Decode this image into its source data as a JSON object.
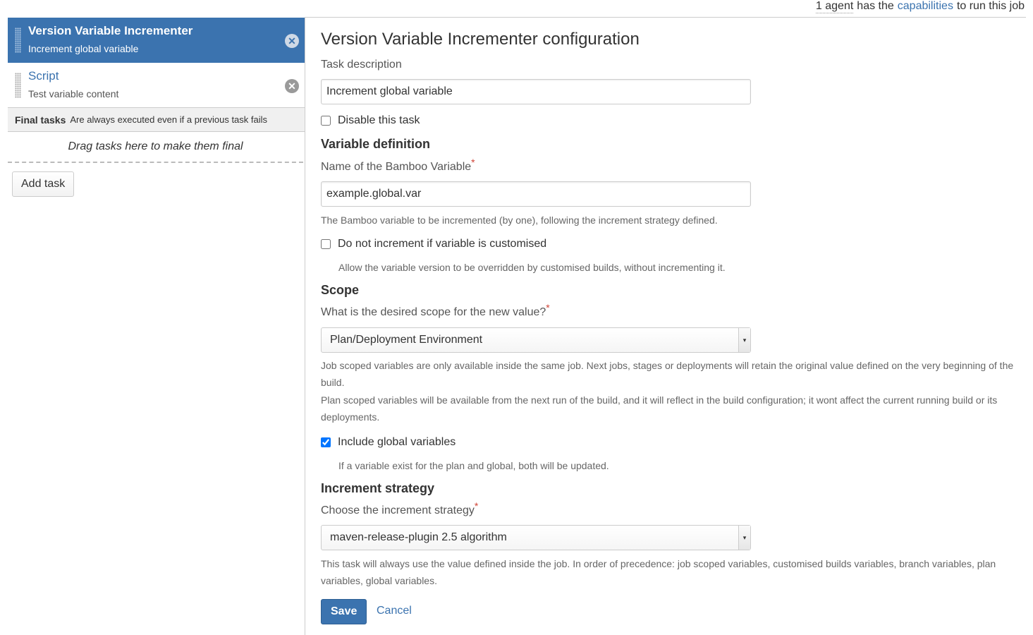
{
  "topbar": {
    "agents_text": "1 agent",
    "has_the": "has the",
    "capabilities_link": "capabilities",
    "tail": "to run this job"
  },
  "tasks": [
    {
      "title": "Version Variable Incrementer",
      "subtitle": "Increment global variable",
      "active": true
    },
    {
      "title": "Script",
      "subtitle": "Test variable content",
      "active": false
    }
  ],
  "final_tasks": {
    "label": "Final tasks",
    "note": "Are always executed even if a previous task fails",
    "dropzone": "Drag tasks here to make them final"
  },
  "add_task_label": "Add task",
  "config": {
    "title": "Version Variable Incrementer configuration",
    "task_description_label": "Task description",
    "task_description_value": "Increment global variable",
    "disable_task_label": "Disable this task",
    "variable_definition_heading": "Variable definition",
    "variable_name_label": "Name of the Bamboo Variable",
    "variable_name_value": "example.global.var",
    "variable_name_help": "The Bamboo variable to be incremented (by one), following the increment strategy defined.",
    "no_increment_label": "Do not increment if variable is customised",
    "no_increment_help": "Allow the variable version to be overridden by customised builds, without incrementing it.",
    "scope_heading": "Scope",
    "scope_label": "What is the desired scope for the new value?",
    "scope_value": "Plan/Deployment Environment",
    "scope_help_1": "Job scoped variables are only available inside the same job. Next jobs, stages or deployments will retain the original value defined on the very beginning of the build.",
    "scope_help_2": "Plan scoped variables will be available from the next run of the build, and it will reflect in the build configuration; it wont affect the current running build or its deployments.",
    "include_global_label": "Include global variables",
    "include_global_checked": true,
    "include_global_help": "If a variable exist for the plan and global, both will be updated.",
    "strategy_heading": "Increment strategy",
    "strategy_label": "Choose the increment strategy",
    "strategy_value": "maven-release-plugin 2.5 algorithm",
    "strategy_help": "This task will always use the value defined inside the job. In order of precedence: job scoped variables, customised builds variables, branch variables, plan variables, global variables.",
    "required_mark": "*"
  },
  "buttons": {
    "save": "Save",
    "cancel": "Cancel"
  },
  "colors": {
    "accent": "#3b73af",
    "required": "#d04437"
  }
}
